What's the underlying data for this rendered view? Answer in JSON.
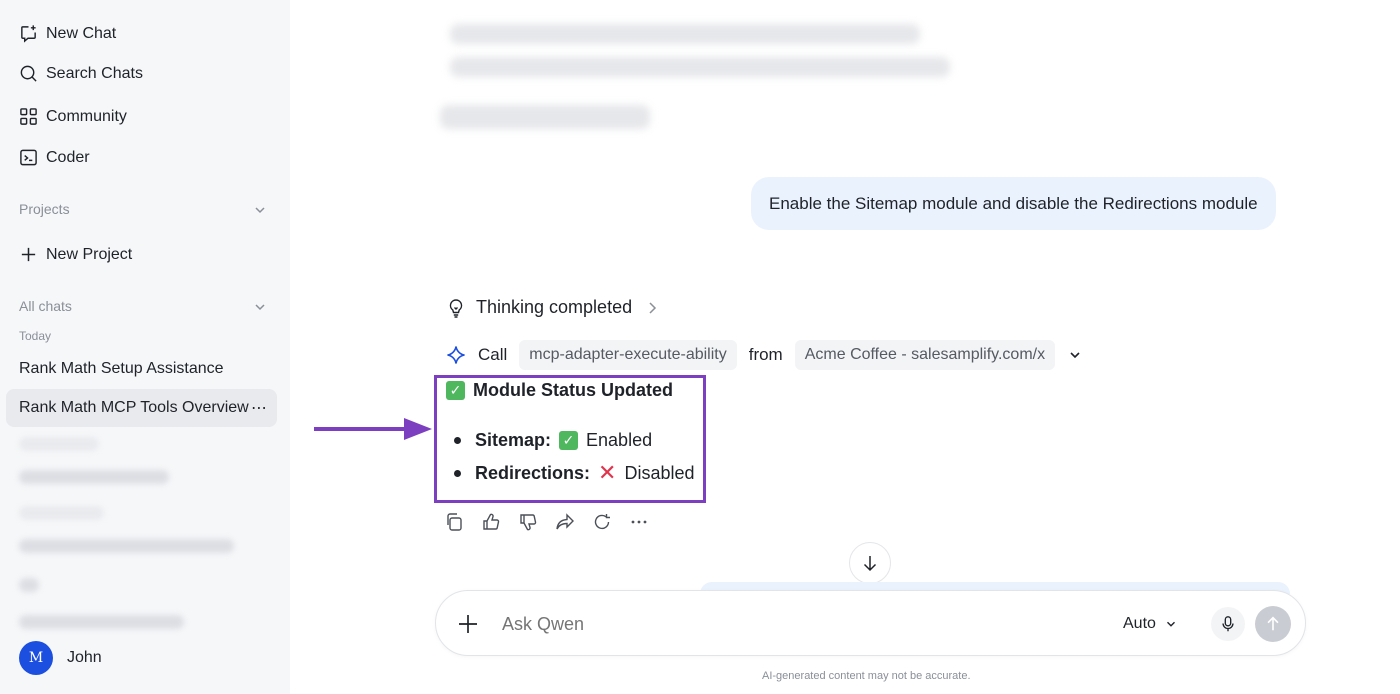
{
  "sidebar": {
    "nav": [
      {
        "label": "New Chat",
        "icon": "new-chat-icon"
      },
      {
        "label": "Search Chats",
        "icon": "search-icon"
      },
      {
        "label": "Community",
        "icon": "grid-icon"
      },
      {
        "label": "Coder",
        "icon": "terminal-icon"
      }
    ],
    "projects_label": "Projects",
    "new_project_label": "New Project",
    "all_chats_label": "All chats",
    "today_label": "Today",
    "chats": [
      {
        "label": "Rank Math Setup Assistance"
      },
      {
        "label": "Rank Math MCP Tools Overview"
      }
    ],
    "more_label": "⋯",
    "user": {
      "initial": "M",
      "name": "John"
    }
  },
  "conversation": {
    "user_message": "Enable the Sitemap module and disable the Redirections module",
    "thinking_label": "Thinking completed",
    "call": {
      "call_label": "Call",
      "tool": "mcp-adapter-execute-ability",
      "from_label": "from",
      "source": "Acme Coffee - salesamplify.com/x"
    },
    "status_title": "Module Status Updated",
    "items": [
      {
        "key": "Sitemap:",
        "value": "Enabled",
        "state": "enabled"
      },
      {
        "key": "Redirections:",
        "value": "Disabled",
        "state": "disabled"
      }
    ]
  },
  "input": {
    "placeholder": "Ask Qwen",
    "mode": "Auto",
    "disclaimer": "AI-generated content may not be accurate."
  },
  "colors": {
    "accent": "#1c4fe0",
    "highlight": "#7b3fc0",
    "user_bubble": "#eaf2fd",
    "enabled": "#4fb75e",
    "disabled": "#e0344d"
  }
}
